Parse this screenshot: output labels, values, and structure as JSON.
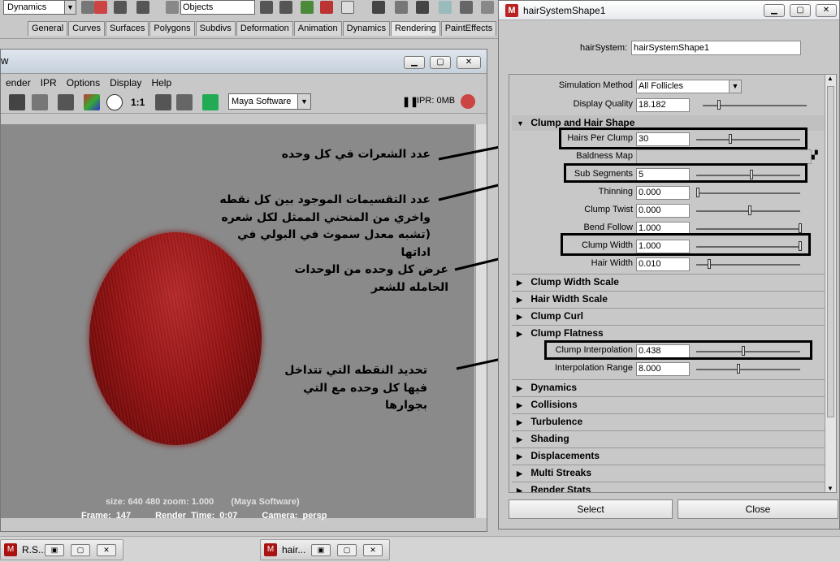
{
  "toolbar": {
    "mode": "Dynamics",
    "selection_mode": "Objects",
    "shelf_tabs": [
      "General",
      "Curves",
      "Surfaces",
      "Polygons",
      "Subdivs",
      "Deformation",
      "Animation",
      "Dynamics",
      "Rendering",
      "PaintEffects"
    ]
  },
  "render_window": {
    "title_fragment": "w",
    "menu": [
      "ender",
      "IPR",
      "Options",
      "Display",
      "Help"
    ],
    "ratio_label": "1:1",
    "renderer": "Maya Software",
    "ipr_status": "IPR: 0MB",
    "size_info": "size:  640  480 zoom: 1.000",
    "software_info": "(Maya Software)",
    "frame": "Frame: 147",
    "render_time": "Render Time: 0:07",
    "camera": "Camera: persp"
  },
  "annotations": {
    "hairs_per_clump": "عدد الشعرات في كل وحده",
    "sub_segments": "عدد التقسيمات الموجود بين كل نقطه واخري من المنحني الممثل لكل شعره (تشبه معدل سموث في البولي في اداتها",
    "clump_width": "عرض كل وحده من الوحدات الحامله للشعر",
    "clump_interpolation": "تحديد النقطه التي تتداخل فيها كل وحده مع التي بجوارها"
  },
  "attr_editor": {
    "title": "hairSystemShape1",
    "node_label": "hairSystem:",
    "node_name": "hairSystemShape1",
    "simulation_method_label": "Simulation Method",
    "simulation_method": "All Follicles",
    "display_quality_label": "Display Quality",
    "display_quality": "18.182",
    "clump_section": "Clump and Hair Shape",
    "attrs": {
      "hairs_per_clump": {
        "label": "Hairs Per Clump",
        "value": "30"
      },
      "baldness_map": {
        "label": "Baldness Map"
      },
      "sub_segments": {
        "label": "Sub Segments",
        "value": "5"
      },
      "thinning": {
        "label": "Thinning",
        "value": "0.000"
      },
      "clump_twist": {
        "label": "Clump Twist",
        "value": "0.000"
      },
      "bend_follow": {
        "label": "Bend Follow",
        "value": "1.000"
      },
      "clump_width": {
        "label": "Clump Width",
        "value": "1.000"
      },
      "hair_width": {
        "label": "Hair Width",
        "value": "0.010"
      },
      "clump_interpolation": {
        "label": "Clump Interpolation",
        "value": "0.438"
      },
      "interpolation_range": {
        "label": "Interpolation Range",
        "value": "8.000"
      }
    },
    "sub_sections": [
      "Clump Width Scale",
      "Hair Width Scale",
      "Clump Curl",
      "Clump Flatness"
    ],
    "sections": [
      "Dynamics",
      "Collisions",
      "Turbulence",
      "Shading",
      "Displacements",
      "Multi Streaks",
      "Render Stats"
    ],
    "select_label": "Select",
    "close_label": "Close"
  },
  "taskbar": {
    "items": [
      "R.S...",
      "hair..."
    ]
  },
  "colors": {
    "hair": "#961414",
    "viewport": "#8a8a8a"
  }
}
